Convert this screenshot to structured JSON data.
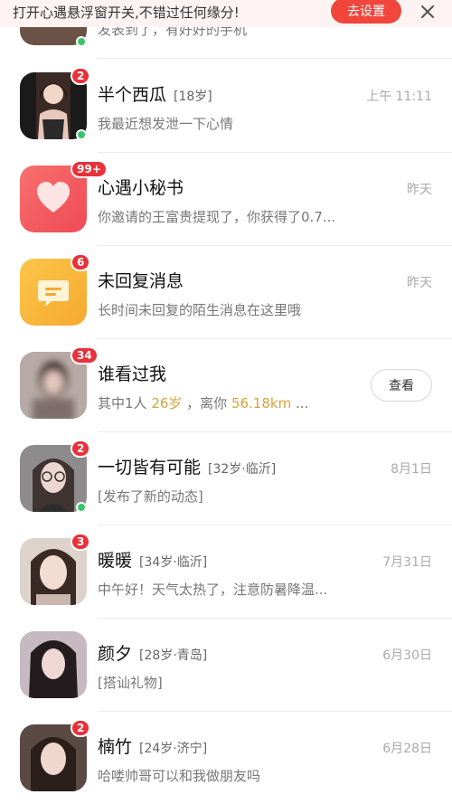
{
  "banner": {
    "text": "打开心遇悬浮窗开关,不错过任何缘分!",
    "button_label": "去设置",
    "close_icon": "close-icon"
  },
  "top_partial": {
    "message": "发表到了，有好好的手机"
  },
  "conversations": [
    {
      "name": "半个西瓜",
      "meta": "[18岁]",
      "time": "上午 11:11",
      "message": "我最近想发泄一下心情",
      "badge": "2",
      "online": true,
      "avatar": "photo-avatar"
    },
    {
      "name": "心遇小秘书",
      "meta": "",
      "time": "昨天",
      "message": "你邀请的王富贵提现了，你获得了0.7...",
      "badge": "99+",
      "online": false,
      "avatar": "heart-icon",
      "avatar_color": "#f45a5e"
    },
    {
      "name": "未回复消息",
      "meta": "",
      "time": "昨天",
      "message": "长时间未回复的陌生消息在这里哦",
      "badge": "6",
      "online": false,
      "avatar": "message-bubble-icon",
      "avatar_color": "#f8b63c"
    },
    {
      "name": "谁看过我",
      "meta": "",
      "message_prefix": "其中1人 ",
      "message_age": "26岁",
      "message_mid": " ，离你 ",
      "message_distance": "56.18km",
      "message_suffix": " ...",
      "button_label": "查看",
      "badge": "34",
      "online": false,
      "avatar": "blurred-photo-avatar"
    },
    {
      "name": "一切皆有可能",
      "meta": "[32岁·临沂]",
      "time": "8月1日",
      "message": "[发布了新的动态]",
      "badge": "2",
      "online": true,
      "avatar": "photo-avatar"
    },
    {
      "name": "暖暖",
      "meta": "[34岁·临沂]",
      "time": "7月31日",
      "message": "中午好！天气太热了，注意防暑降温...",
      "badge": "3",
      "online": false,
      "avatar": "photo-avatar"
    },
    {
      "name": "颜夕",
      "meta": "[28岁·青岛]",
      "time": "6月30日",
      "message": "[搭讪礼物]",
      "badge": "",
      "online": false,
      "avatar": "photo-avatar"
    },
    {
      "name": "楠竹",
      "meta": "[24岁·济宁]",
      "time": "6月28日",
      "message": "哈喽帅哥可以和我做朋友吗",
      "badge": "2",
      "online": false,
      "avatar": "photo-avatar"
    }
  ],
  "colors": {
    "accent": "#f0463c",
    "badge": "#e8313a",
    "online": "#3ac56a",
    "highlight": "#d9a23a"
  }
}
